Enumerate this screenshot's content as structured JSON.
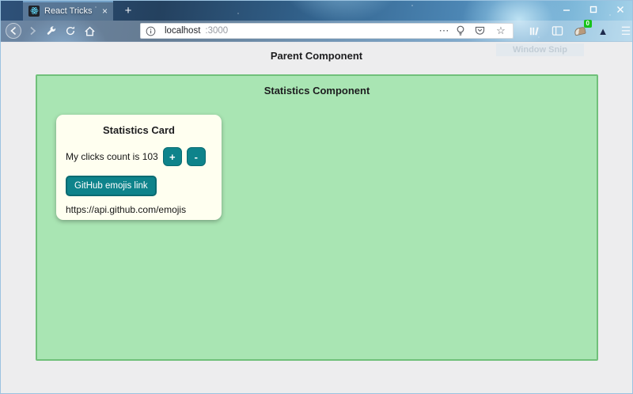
{
  "browser": {
    "tab_title": "React Tricks",
    "tab_close_glyph": "×",
    "new_tab_label": "+",
    "url_host": "localhost",
    "url_port": ":3000",
    "page_action_dots": "⋯",
    "bookmark_star": "☆",
    "extension_badge": "0",
    "extension_triangle": "▲",
    "menu_glyph": "☰"
  },
  "page": {
    "snip_overlay_label": "Window Snip",
    "parent_heading": "Parent Component",
    "stats_heading": "Statistics Component",
    "card": {
      "title": "Statistics Card",
      "clicks_label": "My clicks count is",
      "clicks_count": "103",
      "increment_label": "+",
      "decrement_label": "-",
      "link_button_label": "GitHub emojis link",
      "api_url": "https://api.github.com/emojis"
    }
  },
  "colors": {
    "accent_teal": "#0e838b",
    "component_green": "#a9e5b3",
    "green_border": "#70c07a",
    "card_ivory": "#fffff0",
    "page_gray": "#ededee"
  }
}
